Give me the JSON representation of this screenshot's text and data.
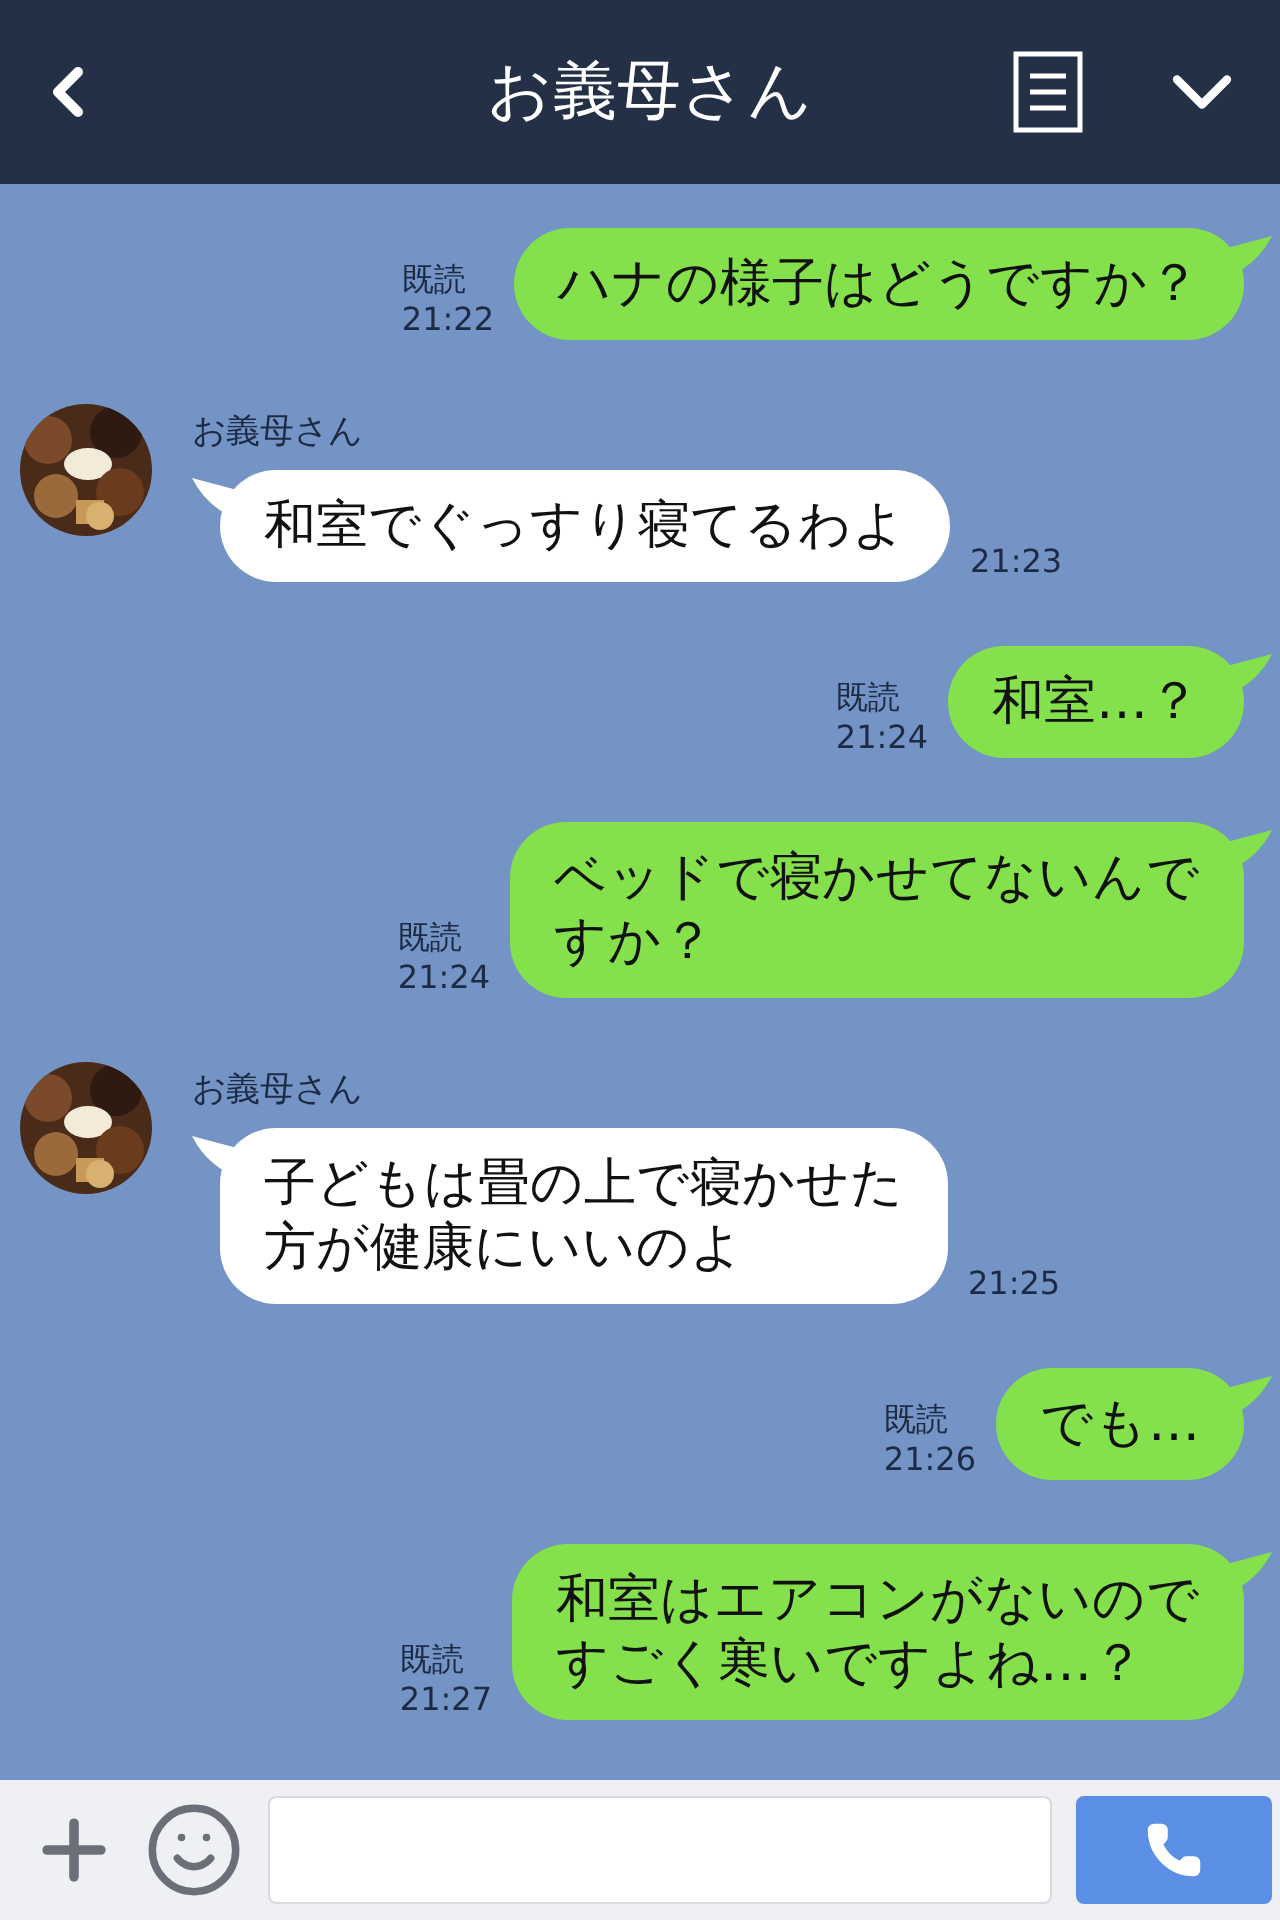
{
  "header": {
    "title": "お義母さん"
  },
  "messages": [
    {
      "kind": "sent",
      "lines": [
        "ハナの様子はどうですか？"
      ],
      "read": "既読",
      "time": "21:22"
    },
    {
      "kind": "received",
      "sender": "お義母さん",
      "lines": [
        "和室でぐっすり寝てるわよ"
      ],
      "time": "21:23"
    },
    {
      "kind": "sent",
      "lines": [
        "和室…？"
      ],
      "read": "既読",
      "time": "21:24"
    },
    {
      "kind": "sent",
      "lines": [
        "ベッドで寝かせてないんで",
        "すか？"
      ],
      "read": "既読",
      "time": "21:24"
    },
    {
      "kind": "received",
      "sender": "お義母さん",
      "lines": [
        "子どもは畳の上で寝かせた",
        "方が健康にいいのよ"
      ],
      "time": "21:25"
    },
    {
      "kind": "sent",
      "lines": [
        "でも…"
      ],
      "read": "既読",
      "time": "21:26"
    },
    {
      "kind": "sent",
      "lines": [
        "和室はエアコンがないので",
        "すごく寒いですよね…？"
      ],
      "read": "既読",
      "time": "21:27"
    }
  ]
}
